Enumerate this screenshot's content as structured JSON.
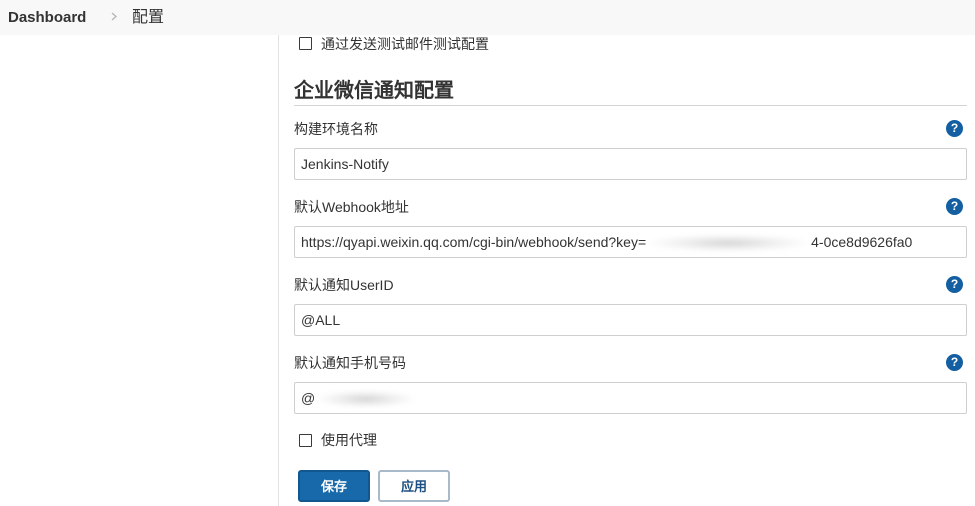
{
  "breadcrumb": {
    "items": [
      {
        "label": "Dashboard"
      },
      {
        "label": "配置"
      }
    ],
    "separator_icon": "chevron-right-icon"
  },
  "test_email_option": {
    "label": "通过发送测试邮件测试配置",
    "checked": false
  },
  "wechat_section": {
    "title": "企业微信通知配置",
    "help_icon": "help-icon",
    "help_glyph": "?",
    "fields": [
      {
        "label": "构建环境名称",
        "value": "Jenkins-Notify"
      },
      {
        "label": "默认Webhook地址",
        "value_prefix": "https://qyapi.weixin.qq.com/cgi-bin/webhook/send?key=",
        "value_suffix": "4-0ce8d9626fa0"
      },
      {
        "label": "默认通知UserID",
        "value": "@ALL"
      },
      {
        "label": "默认通知手机号码",
        "value_prefix": "@"
      }
    ],
    "proxy_option": {
      "label": "使用代理",
      "checked": false
    }
  },
  "actions": {
    "save_label": "保存",
    "apply_label": "应用"
  },
  "colors": {
    "breadcrumb_background": "#f8f8f8",
    "primary_button": "#1769aa",
    "help_icon": "#135fa1"
  }
}
